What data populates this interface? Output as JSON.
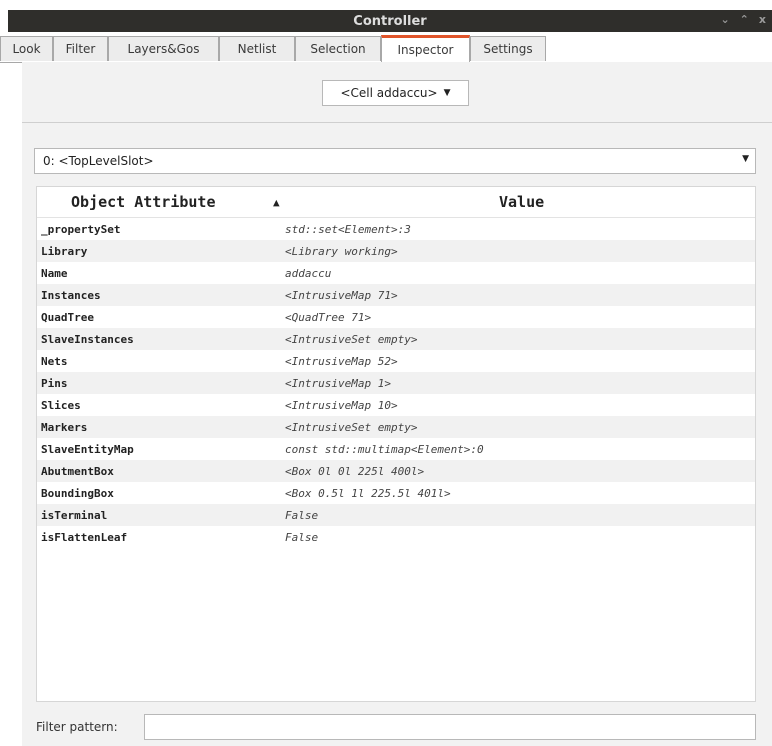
{
  "window": {
    "title": "Controller",
    "controls": [
      "⌄",
      "⌃",
      "x"
    ]
  },
  "tabs": [
    {
      "label": "Look",
      "active": false
    },
    {
      "label": "Filter",
      "active": false
    },
    {
      "label": "Layers&Gos",
      "active": false
    },
    {
      "label": "Netlist",
      "active": false
    },
    {
      "label": "Selection",
      "active": false
    },
    {
      "label": "Inspector",
      "active": true
    },
    {
      "label": "Settings",
      "active": false
    }
  ],
  "inspector": {
    "cell_select": "<Cell addaccu>",
    "path": "0: <TopLevelSlot>",
    "table": {
      "col_attr": "Object Attribute",
      "col_value": "Value",
      "sort_indicator": "▲",
      "rows": [
        {
          "attr": "_propertySet",
          "value": "std::set<Element>:3"
        },
        {
          "attr": "Library",
          "value": "<Library working>"
        },
        {
          "attr": "Name",
          "value": "addaccu"
        },
        {
          "attr": "Instances",
          "value": "<IntrusiveMap 71>"
        },
        {
          "attr": "QuadTree",
          "value": "<QuadTree 71>"
        },
        {
          "attr": "SlaveInstances",
          "value": "<IntrusiveSet empty>"
        },
        {
          "attr": "Nets",
          "value": "<IntrusiveMap 52>"
        },
        {
          "attr": "Pins",
          "value": "<IntrusiveMap 1>"
        },
        {
          "attr": "Slices",
          "value": "<IntrusiveMap 10>"
        },
        {
          "attr": "Markers",
          "value": "<IntrusiveSet empty>"
        },
        {
          "attr": "SlaveEntityMap",
          "value": "const std::multimap<Element>:0"
        },
        {
          "attr": "AbutmentBox",
          "value": "<Box 0l 0l 225l 400l>"
        },
        {
          "attr": "BoundingBox",
          "value": "<Box 0.5l 1l 225.5l 401l>"
        },
        {
          "attr": "isTerminal",
          "value": "False"
        },
        {
          "attr": "isFlattenLeaf",
          "value": "False"
        }
      ]
    },
    "filter_label": "Filter pattern:",
    "filter_value": ""
  }
}
